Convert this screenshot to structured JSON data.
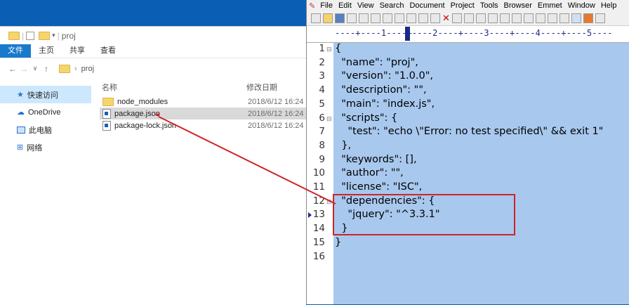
{
  "explorer": {
    "title": "proj",
    "ribbon_tabs": [
      "文件",
      "主页",
      "共享",
      "查看"
    ],
    "breadcrumb": "proj",
    "sidebar": [
      "快速访问",
      "OneDrive",
      "此电脑",
      "网络"
    ],
    "columns": {
      "name": "名称",
      "modified": "修改日期"
    },
    "files": [
      {
        "name": "node_modules",
        "date": "2018/6/12 16:24"
      },
      {
        "name": "package.json",
        "date": "2018/6/12 16:24"
      },
      {
        "name": "package-lock.json",
        "date": "2018/6/12 16:24"
      }
    ]
  },
  "editor": {
    "menu": [
      "File",
      "Edit",
      "View",
      "Search",
      "Document",
      "Project",
      "Tools",
      "Browser",
      "Emmet",
      "Window",
      "Help"
    ],
    "ruler_text": "----+----1----+----2----+----3----+----4----+----5----",
    "lines": [
      "{",
      "  \"name\": \"proj\",",
      "  \"version\": \"1.0.0\",",
      "  \"description\": \"\",",
      "  \"main\": \"index.js\",",
      "  \"scripts\": {",
      "    \"test\": \"echo \\\"Error: no test specified\\\" && exit 1\"",
      "  },",
      "  \"keywords\": [],",
      "  \"author\": \"\",",
      "  \"license\": \"ISC\",",
      "  \"dependencies\": {",
      "    \"jquery\": \"^3.3.1\"",
      "  }",
      "}",
      ""
    ],
    "line_numbers": [
      "1",
      "2",
      "3",
      "4",
      "5",
      "6",
      "7",
      "8",
      "9",
      "10",
      "11",
      "12",
      "13",
      "14",
      "15",
      "16"
    ]
  },
  "colors": {
    "highlight": "#a8c8ee",
    "annotation": "#d0242a"
  }
}
